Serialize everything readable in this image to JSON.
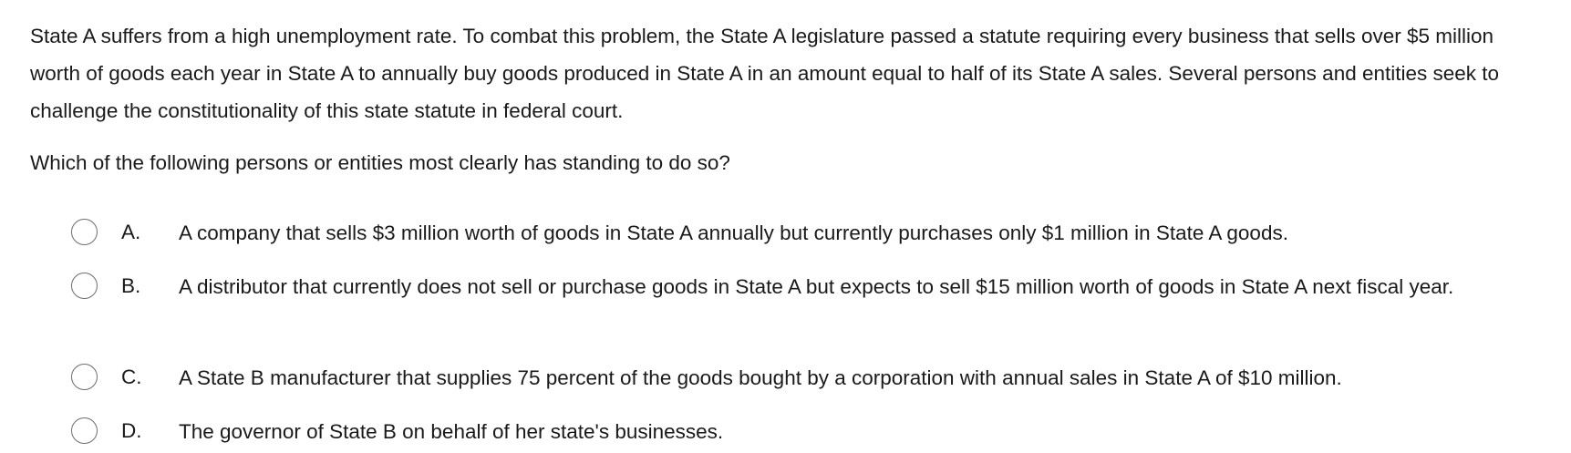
{
  "question": {
    "stem": "State A suffers from a high unemployment rate.  To combat this problem, the State A legislature passed a statute requiring every business that sells over $5 million worth of goods each year in State A to annually buy goods produced in State A in an amount equal to half of its State A sales.  Several persons and entities seek to challenge the constitutionality of this state statute in federal court.",
    "prompt": "Which of the following persons or entities most clearly has standing to do so?",
    "options": [
      {
        "letter": "A.",
        "text": "A company that sells $3 million worth of goods in State A annually but currently purchases only $1 million in State A goods.",
        "selected": false
      },
      {
        "letter": "B.",
        "text": "A distributor that currently does not sell or purchase goods in State A but expects to sell $15 million worth of goods in State A next fiscal year.",
        "selected": false
      },
      {
        "letter": "C.",
        "text": "A State B manufacturer that supplies 75 percent of the goods bought by a corporation with annual sales in State A of $10 million.",
        "selected": false
      },
      {
        "letter": "D.",
        "text": "The governor of State B on behalf of her state's businesses.",
        "selected": false
      }
    ]
  }
}
